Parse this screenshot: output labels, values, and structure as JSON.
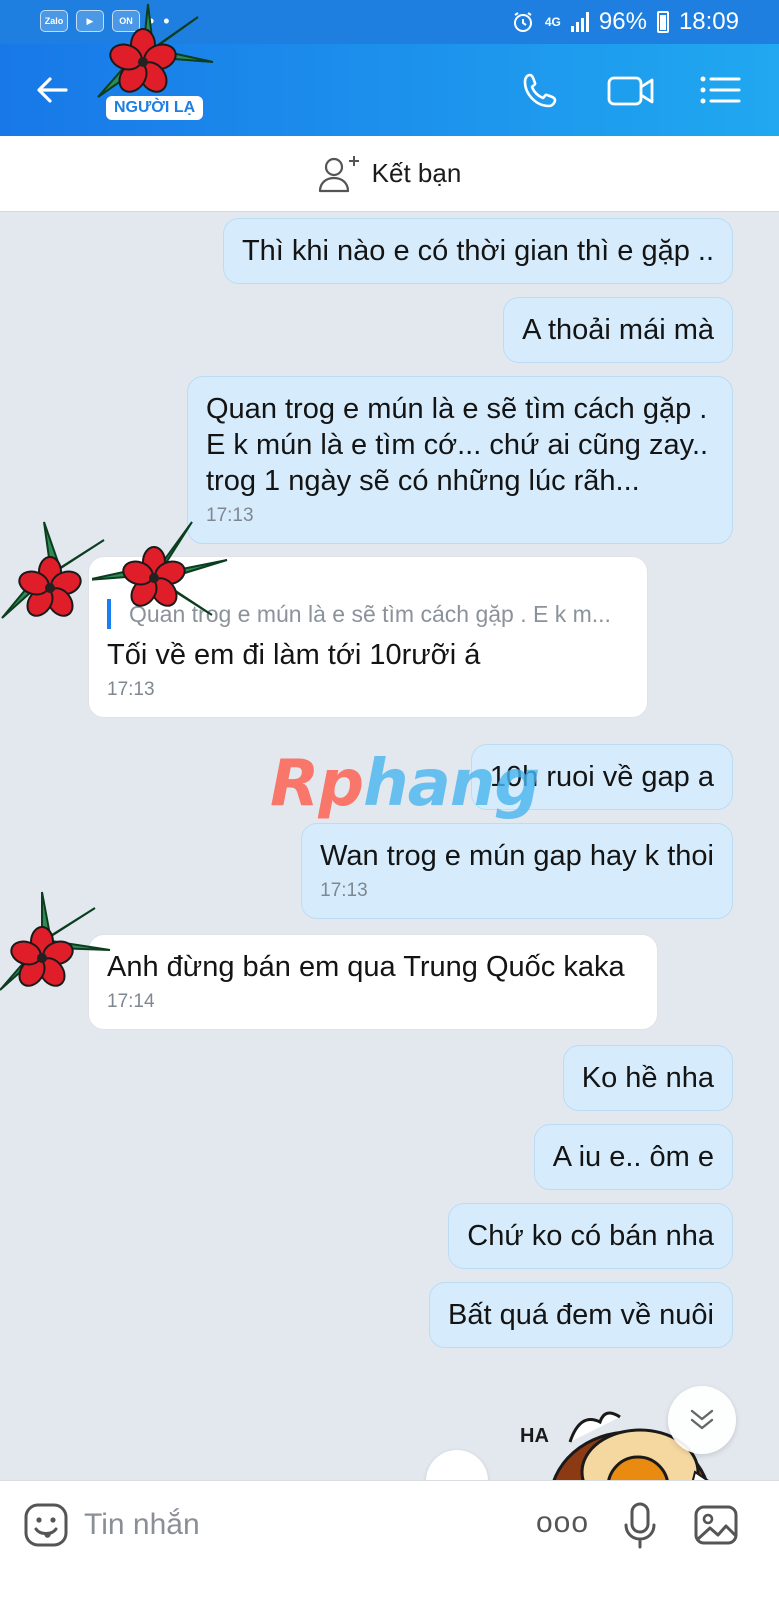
{
  "status_bar": {
    "apps": [
      "Zalo",
      "▶",
      "ON"
    ],
    "dots": "• •",
    "network": "4G",
    "battery": "96%",
    "time": "18:09"
  },
  "header": {
    "badge": "NGƯỜI LẠ",
    "icons": [
      "back-arrow-icon",
      "phone-icon",
      "video-call-icon",
      "menu-list-icon"
    ]
  },
  "friend_bar": {
    "label": "Kết bạn"
  },
  "messages": [
    {
      "side": "sent",
      "text": "Thì khi nào e có thời gian thì e gặp .."
    },
    {
      "side": "sent",
      "text": "A thoải mái mà"
    },
    {
      "side": "sent",
      "lines": [
        "Quan trog e mún là e sẽ tìm cách gặp .",
        "E k mún là e tìm cớ... chứ ai cũng zay..",
        "trog 1 ngày sẽ có những lúc rãh..."
      ],
      "time": "17:13"
    },
    {
      "side": "recv",
      "quote": "Quan trog e mún là e sẽ tìm cách gặp . E k m...",
      "text": "Tối về em đi làm tới 10rưỡi á",
      "time": "17:13"
    },
    {
      "side": "sent",
      "text": "10h ruoi về gap a"
    },
    {
      "side": "sent",
      "text": "Wan trog e mún gap hay k thoi",
      "time": "17:13"
    },
    {
      "side": "recv",
      "text": "Anh đừng bán em qua Trung Quốc kaka",
      "time": "17:14"
    },
    {
      "side": "sent",
      "text": "Ko hề nha"
    },
    {
      "side": "sent",
      "text": "A iu e..  ôm e"
    },
    {
      "side": "sent",
      "text": "Chứ ko có bán nha"
    },
    {
      "side": "sent",
      "text": "Bất quá đem về nuôi"
    }
  ],
  "watermark": {
    "part1": "Rp",
    "part2": "hang"
  },
  "sticker": {
    "text": "HA"
  },
  "input_bar": {
    "placeholder": "Tin nhắn",
    "more": "ooo"
  },
  "colors": {
    "header_start": "#1878e8",
    "header_end": "#20a8f0",
    "sent_bubble": "#d6ecfc",
    "recv_bubble": "#ffffff",
    "chat_bg": "#e3e8ef"
  }
}
